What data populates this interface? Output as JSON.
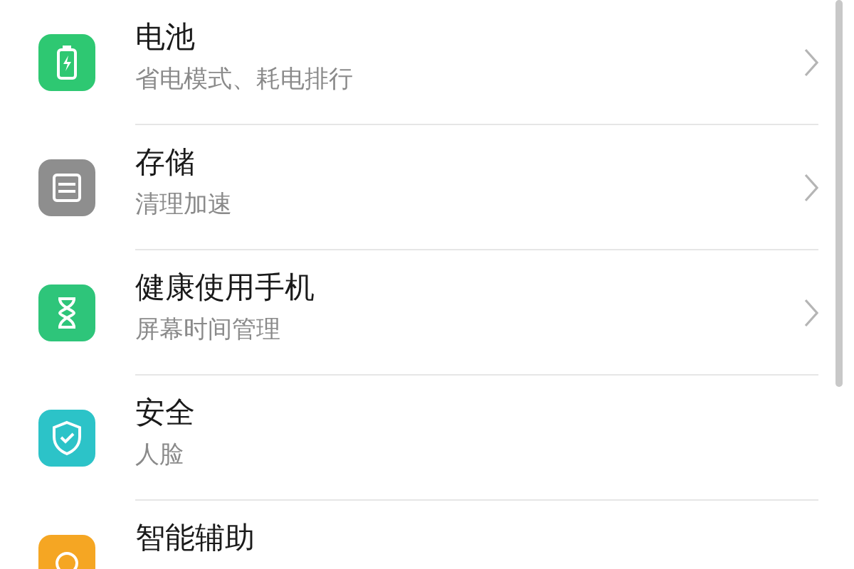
{
  "settings_items": [
    {
      "kind": "battery",
      "color": "#2ec872",
      "title": "电池",
      "subtitle": "省电模式、耗电排行",
      "chevron": true
    },
    {
      "kind": "storage",
      "color": "#8e8e8e",
      "title": "存储",
      "subtitle": "清理加速",
      "chevron": true
    },
    {
      "kind": "hourglass",
      "color": "#2ec57a",
      "title": "健康使用手机",
      "subtitle": "屏幕时间管理",
      "chevron": true
    },
    {
      "kind": "shield",
      "color": "#2cc3c8",
      "title": "安全",
      "subtitle": "人脸",
      "chevron": false
    },
    {
      "kind": "assist",
      "color": "#f5a623",
      "title": "智能辅助",
      "chevron": false
    }
  ]
}
